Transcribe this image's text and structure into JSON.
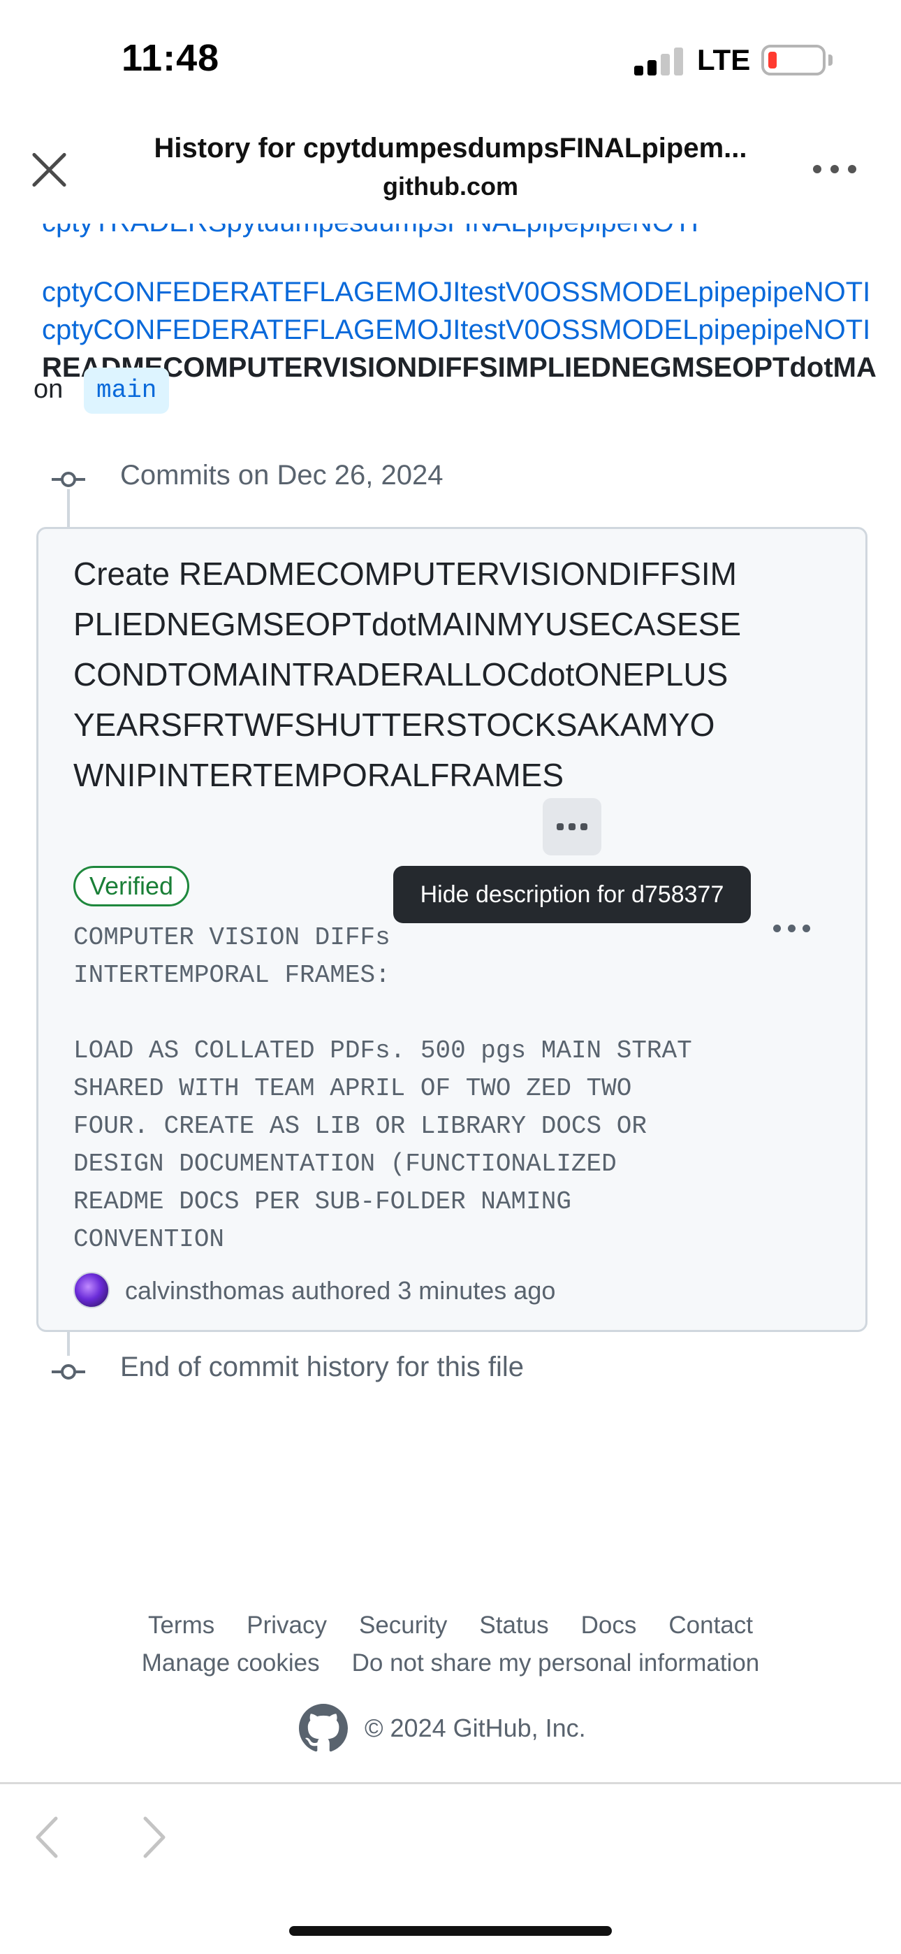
{
  "status_bar": {
    "time": "11:48",
    "network": "LTE",
    "battery_level": 0.1,
    "battery_color": "#ff3b30"
  },
  "browser": {
    "title": "History for cpytdumpesdumpsFINALpipem...",
    "domain": "github.com",
    "close_icon": "close-icon",
    "more_icon": "more-horizontal-icon"
  },
  "breadcrumb": {
    "line1": "cptyCONFEDERATEFLAGEMOJItestV0OSSMODELpipepipeNOTI",
    "line2": "cptyCONFEDERATEFLAGEMOJItestV0OSSMODELpipepipeNOTI",
    "line3": "READMECOMPUTERVISIONDIFFSIMPLIEDNEGMSEOPTdotMA",
    "on_label": "on",
    "branch": "main"
  },
  "timeline": {
    "commits_heading": "Commits on Dec 26, 2024",
    "end_text": "End of commit history for this file"
  },
  "commit": {
    "title": "Create READMECOMPUTERVISIONDIFFSIMPLIEDNEGMSEOPTdotMAINMYUSECASESECONDTOMAINTRADERALLOCdotONEPLUSYEARSFRTWFSHUTTERSTOCKSAKAMYOWNIPINTERTEMPORALFRAMES",
    "verified_label": "Verified",
    "tooltip": "Hide description for d758377",
    "description": "COMPUTER VISION DIFFs\nINTERTEMPORAL FRAMES:\n\nLOAD AS COLLATED PDFs. 500 pgs MAIN STRAT\nSHARED WITH TEAM APRIL OF TWO ZED TWO\nFOUR. CREATE AS LIB OR LIBRARY DOCS OR\nDESIGN DOCUMENTATION (FUNCTIONALIZED\nREADME DOCS PER SUB-FOLDER NAMING\nCONVENTION",
    "author": "calvinsthomas",
    "authored_text": "authored 3 minutes ago"
  },
  "footer": {
    "row1": [
      "Terms",
      "Privacy",
      "Security",
      "Status",
      "Docs",
      "Contact"
    ],
    "row2": [
      "Manage cookies",
      "Do not share my personal information"
    ],
    "copyright": "© 2024 GitHub, Inc."
  },
  "colors": {
    "link": "#0969da",
    "muted": "#59636e",
    "verified": "#1a7f37",
    "card_bg": "#f6f8fa",
    "tooltip_bg": "#25292e"
  }
}
